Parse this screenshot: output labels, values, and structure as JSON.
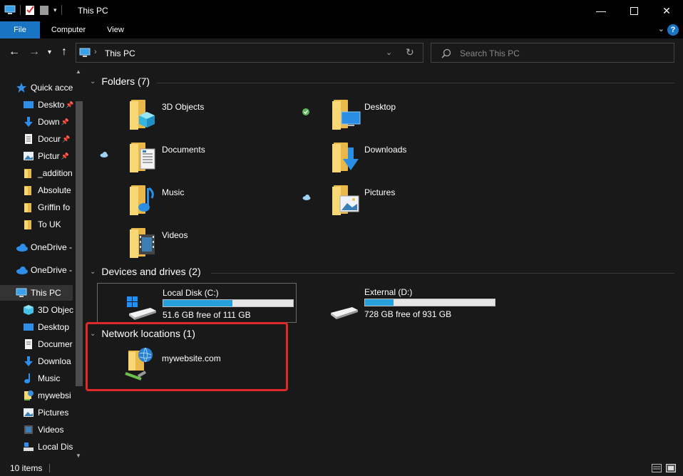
{
  "window": {
    "title": "This PC",
    "minimize_icon": "minimize-icon",
    "maximize_icon": "maximize-icon",
    "close_icon": "close-icon"
  },
  "ribbon": {
    "tabs": [
      {
        "label": "File"
      },
      {
        "label": "Computer"
      },
      {
        "label": "View"
      }
    ],
    "help_label": "?"
  },
  "address": {
    "path_label": "This PC",
    "search_placeholder": "Search This PC"
  },
  "sidebar": {
    "items": [
      {
        "label": "Quick acce",
        "icon": "star-icon"
      },
      {
        "label": "Deskto",
        "icon": "desktop-icon",
        "pinned": true
      },
      {
        "label": "Down",
        "icon": "download-icon",
        "pinned": true
      },
      {
        "label": "Docur",
        "icon": "document-icon",
        "pinned": true
      },
      {
        "label": "Pictur",
        "icon": "pictures-icon",
        "pinned": true
      },
      {
        "label": "_addition",
        "icon": "folder-icon"
      },
      {
        "label": "Absolute",
        "icon": "folder-icon"
      },
      {
        "label": "Griffin fo",
        "icon": "folder-icon"
      },
      {
        "label": "To UK",
        "icon": "folder-icon"
      },
      {
        "label": "OneDrive -",
        "icon": "cloud-icon"
      },
      {
        "label": "OneDrive -",
        "icon": "cloud-icon"
      },
      {
        "label": "This PC",
        "icon": "computer-icon",
        "selected": true
      },
      {
        "label": "3D Objec",
        "icon": "cube-icon"
      },
      {
        "label": "Desktop",
        "icon": "desktop-icon"
      },
      {
        "label": "Documer",
        "icon": "document-icon"
      },
      {
        "label": "Downloa",
        "icon": "download-icon"
      },
      {
        "label": "Music",
        "icon": "music-icon"
      },
      {
        "label": "mywebsi",
        "icon": "network-location-icon"
      },
      {
        "label": "Pictures",
        "icon": "pictures-icon"
      },
      {
        "label": "Videos",
        "icon": "videos-icon"
      },
      {
        "label": "Local Dis",
        "icon": "drive-icon"
      }
    ]
  },
  "groups": {
    "folders": {
      "header": "Folders (7)",
      "items": [
        {
          "label": "3D Objects",
          "icon": "cube-icon"
        },
        {
          "label": "Desktop",
          "icon": "desktop-icon",
          "status": "synced-check-icon"
        },
        {
          "label": "Documents",
          "icon": "document-icon",
          "status": "cloud-status-icon"
        },
        {
          "label": "Downloads",
          "icon": "download-icon"
        },
        {
          "label": "Music",
          "icon": "music-icon"
        },
        {
          "label": "Pictures",
          "icon": "pictures-icon",
          "status": "cloud-status-icon"
        },
        {
          "label": "Videos",
          "icon": "videos-icon"
        }
      ]
    },
    "drives": {
      "header": "Devices and drives (2)",
      "items": [
        {
          "label": "Local Disk (C:)",
          "free_text": "51.6 GB free of 111 GB",
          "used_fraction": 0.535
        },
        {
          "label": "External (D:)",
          "free_text": "728 GB free of 931 GB",
          "used_fraction": 0.218
        }
      ]
    },
    "network": {
      "header": "Network locations (1)",
      "items": [
        {
          "label": "mywebsite.com",
          "icon": "network-location-icon"
        }
      ]
    }
  },
  "status": {
    "items_count": "10 items"
  },
  "colors": {
    "accent": "#1a74c4",
    "drive_fill": "#26a0da",
    "highlight": "#e02a2a",
    "folder": "#f8d775"
  }
}
